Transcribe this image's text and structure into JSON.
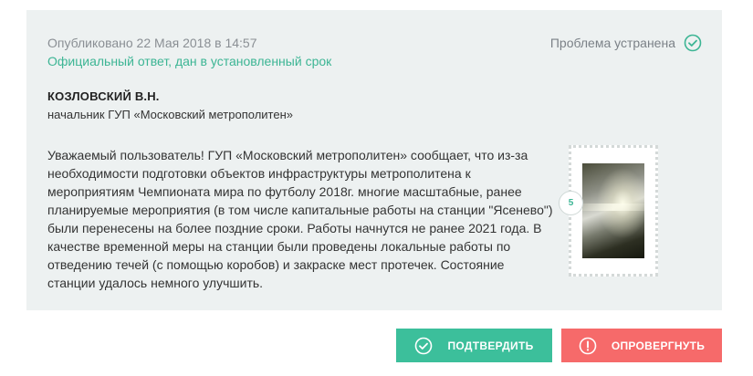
{
  "card": {
    "published": "Опубликовано 22 Мая 2018 в 14:57",
    "official_note": "Официальный ответ, дан в установленный срок",
    "status": {
      "label": "Проблема устранена",
      "icon": "check-circle-icon",
      "color": "#3cb594"
    },
    "author": {
      "name": "КОЗЛОВСКИЙ В.Н.",
      "position": "начальник ГУП «Московский метрополитен»"
    },
    "answer": "Уважаемый пользователь! ГУП «Московский метрополитен» сообщает, что из-за необходимости подготовки объектов инфраструктуры метрополитена к мероприятиям Чемпионата мира по футболу 2018г. многие масштабные, ранее планируемые мероприятия (в том числе капитальные работы на станции \"Ясенево\") были перенесены на более поздние сроки. Работы начнутся не ранее 2021 года. В качестве временной меры на станции были проведены локальные работы по отведению течей (с помощью коробов) и закраске мест протечек. Состояние станции удалось немного улучшить.",
    "photos": {
      "count": "5"
    }
  },
  "actions": {
    "confirm": {
      "label": "ПОДТВЕРДИТЬ",
      "icon": "check-circle-icon",
      "color": "#3cbf9b"
    },
    "refute": {
      "label": "ОПРОВЕРГНУТЬ",
      "icon": "exclamation-circle-icon",
      "color": "#f66a6a"
    }
  }
}
